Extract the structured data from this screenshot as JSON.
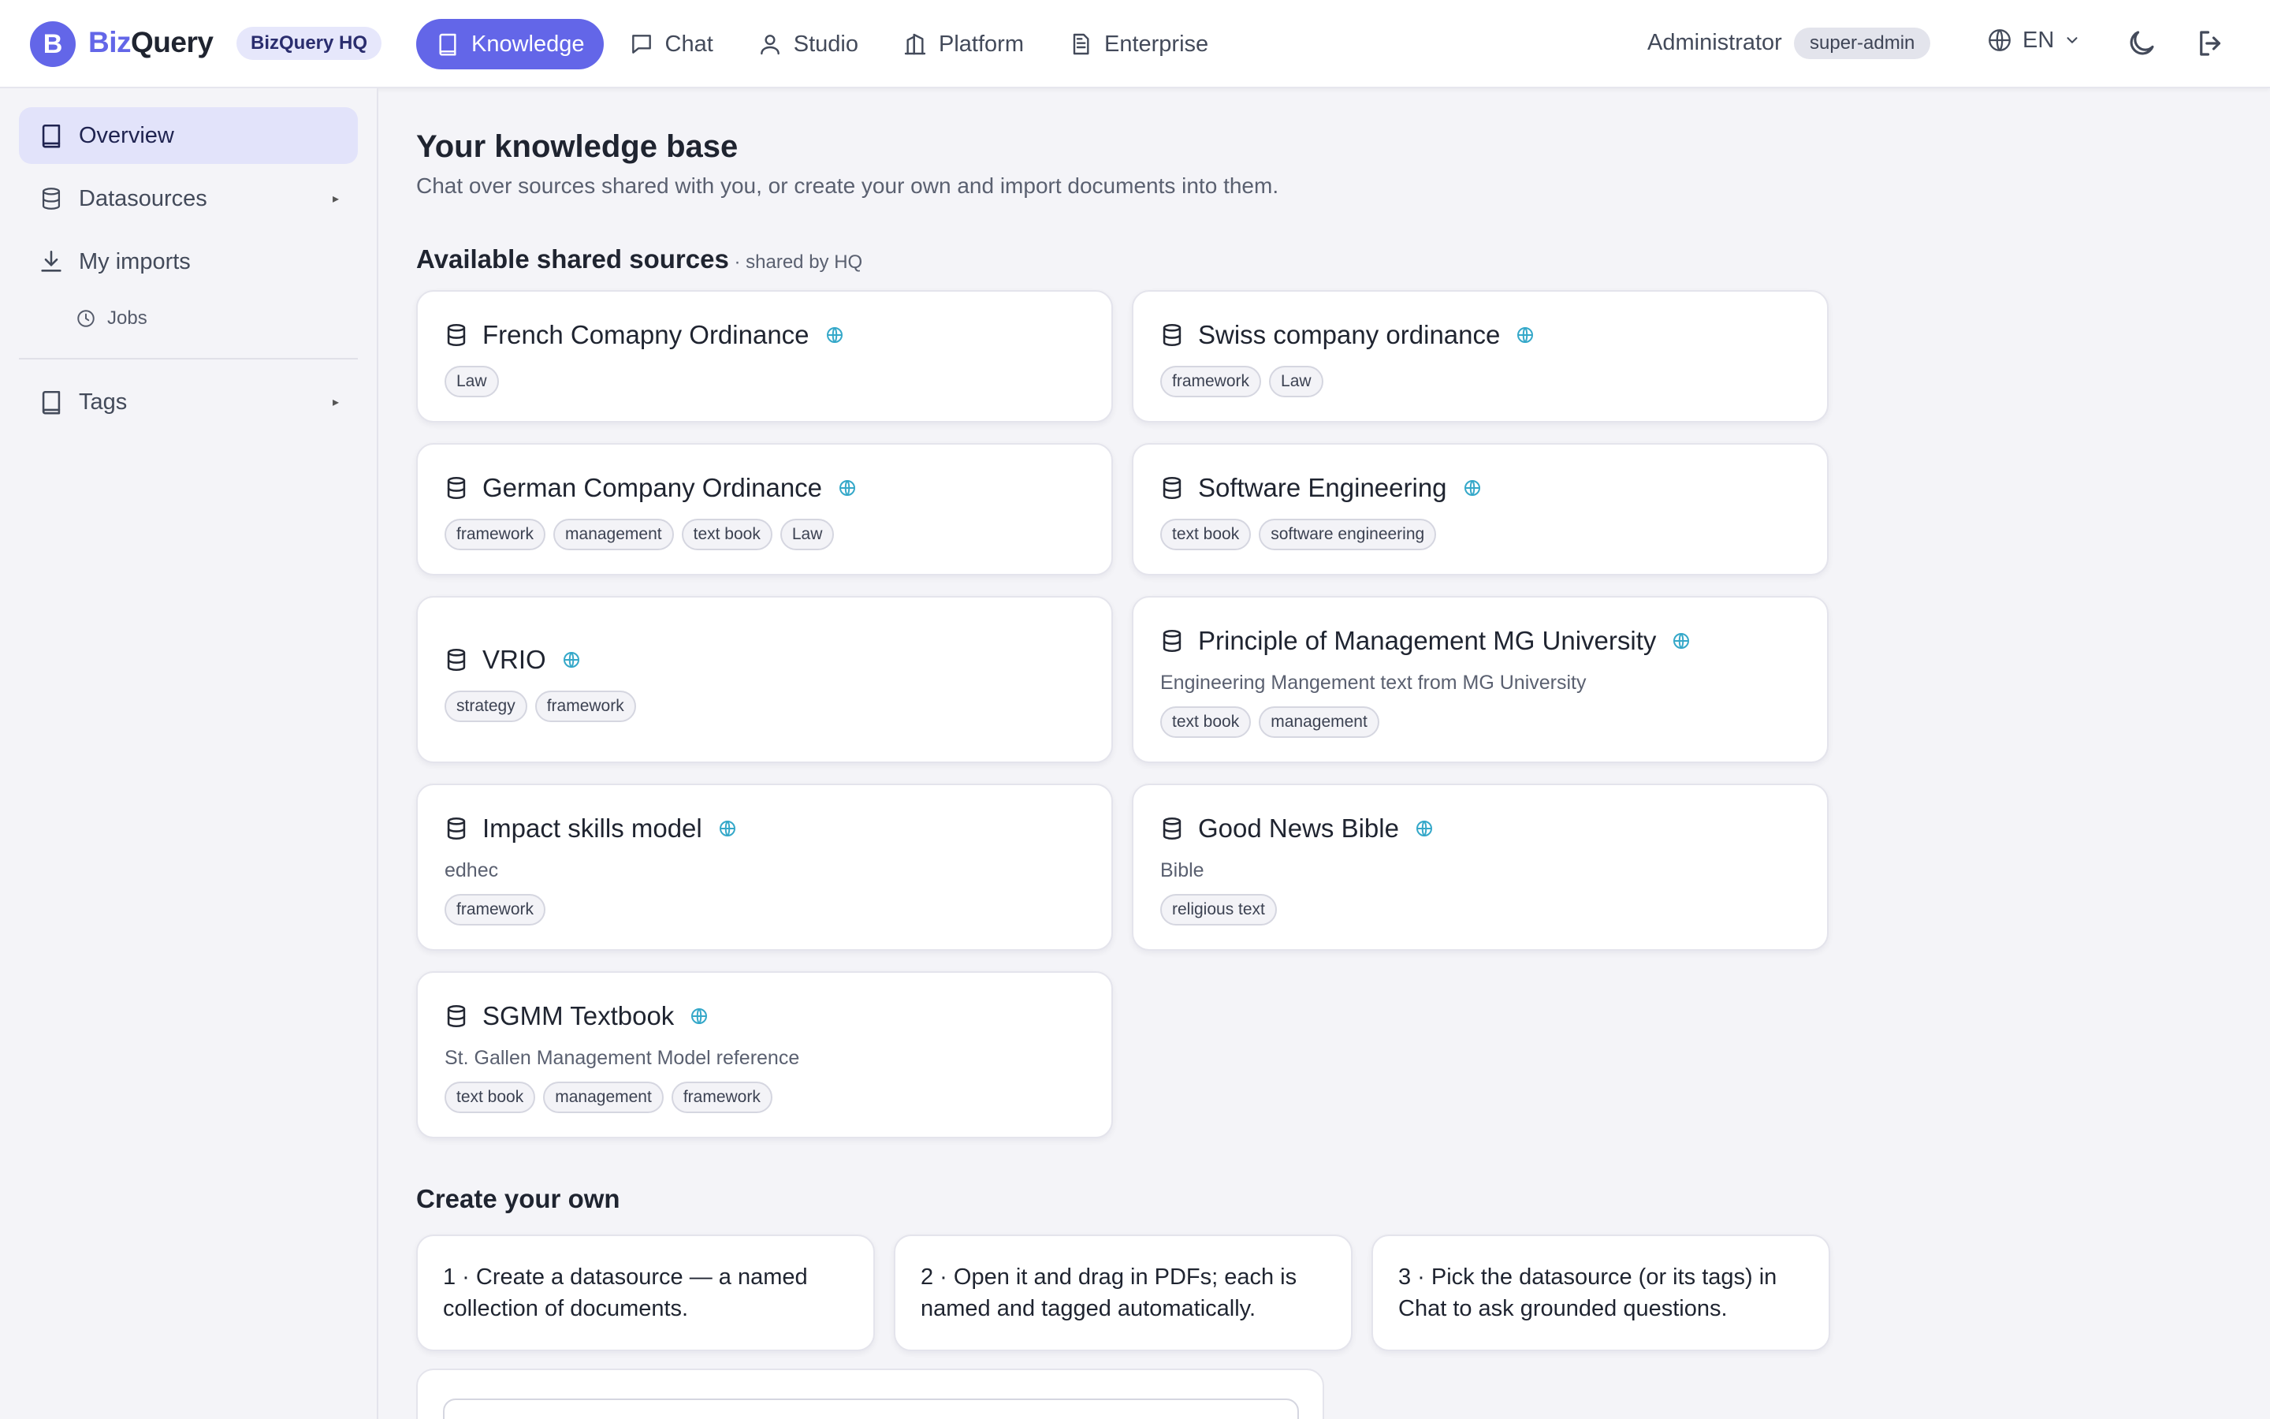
{
  "brand": {
    "logo_letter": "B",
    "name_part1": "Biz",
    "name_part2": "Query",
    "org": "BizQuery HQ"
  },
  "nav": [
    {
      "label": "Knowledge",
      "icon": "book-icon",
      "active": true
    },
    {
      "label": "Chat",
      "icon": "chat-icon"
    },
    {
      "label": "Studio",
      "icon": "user-icon"
    },
    {
      "label": "Platform",
      "icon": "building-icon"
    },
    {
      "label": "Enterprise",
      "icon": "document-icon"
    }
  ],
  "user": {
    "name": "Administrator",
    "role": "super-admin",
    "language": "EN"
  },
  "sidebar": {
    "items": [
      {
        "label": "Overview",
        "icon": "book-icon"
      },
      {
        "label": "Datasources",
        "icon": "database-icon",
        "expandable": true
      },
      {
        "label": "My imports",
        "icon": "download-icon"
      },
      {
        "label": "Jobs",
        "icon": "clock-icon"
      },
      {
        "label": "Tags",
        "icon": "book-icon",
        "expandable": true
      }
    ]
  },
  "main": {
    "title": "Your knowledge base",
    "subtitle": "Chat over sources shared with you, or create your own and import documents into them.",
    "shared_heading": "Available shared sources",
    "shared_by": " · shared by HQ",
    "sources": [
      {
        "title": "French Comapny Ordinance",
        "desc": "",
        "tags": [
          "Law"
        ]
      },
      {
        "title": "Swiss company ordinance",
        "desc": "",
        "tags": [
          "framework",
          "Law"
        ]
      },
      {
        "title": "German Company Ordinance",
        "desc": "",
        "tags": [
          "framework",
          "management",
          "text book",
          "Law"
        ]
      },
      {
        "title": "Software Engineering",
        "desc": "",
        "tags": [
          "text book",
          "software engineering"
        ]
      },
      {
        "title": "VRIO",
        "desc": "",
        "tags": [
          "strategy",
          "framework"
        ]
      },
      {
        "title": "Principle of Management MG University",
        "desc": "Engineering Mangement text from MG University",
        "tags": [
          "text book",
          "management"
        ]
      },
      {
        "title": "Impact skills model",
        "desc": "edhec",
        "tags": [
          "framework"
        ]
      },
      {
        "title": "Good News Bible",
        "desc": "Bible",
        "tags": [
          "religious text"
        ]
      },
      {
        "title": "SGMM Textbook",
        "desc": "St. Gallen Management Model reference",
        "tags": [
          "text book",
          "management",
          "framework"
        ]
      }
    ],
    "create_heading": "Create your own",
    "steps": [
      "1 · Create a datasource — a named collection of documents.",
      "2 · Open it and drag in PDFs; each is named and tagged automatically.",
      "3 · Pick the datasource (or its tags) in Chat to ask grounded questions."
    ]
  },
  "colors": {
    "accent": "#6366e8",
    "globe": "#35a8c9",
    "background": "#f4f4f8"
  }
}
